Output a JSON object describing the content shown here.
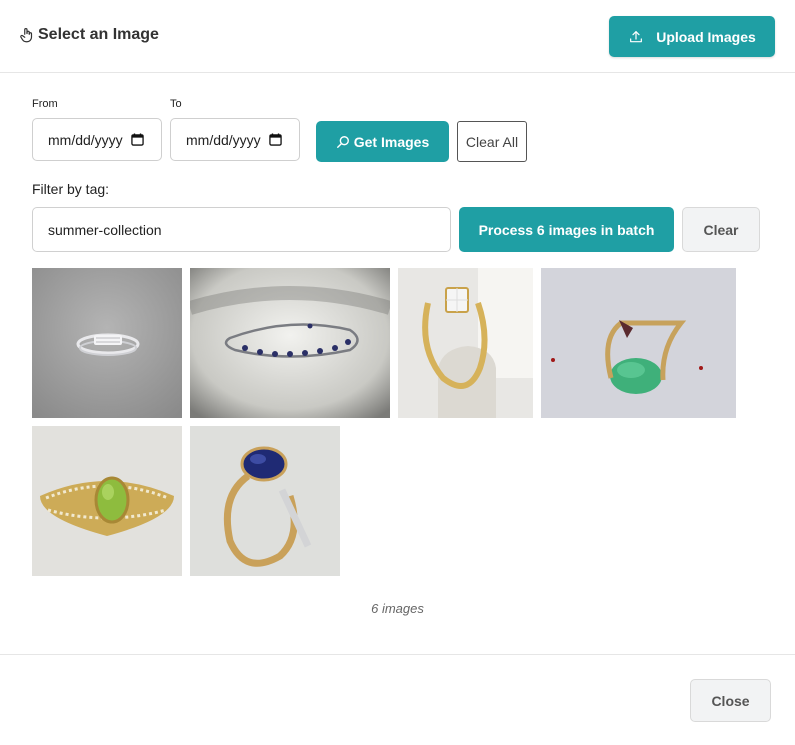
{
  "dialog": {
    "title": "Select an Image",
    "upload_label": "Upload Images"
  },
  "filters": {
    "from_label": "From",
    "to_label": "To",
    "from_placeholder": "mm/dd/yyyy",
    "to_placeholder": "mm/dd/yyyy",
    "get_images_label": "Get Images",
    "clear_all_label": "Clear All",
    "tag_label": "Filter by tag:",
    "tag_value": "summer-collection",
    "process_label": "Process 6 images in batch",
    "clear_label": "Clear"
  },
  "images": [
    {
      "name": "white-gold-band-ring"
    },
    {
      "name": "sapphire-tennis-bracelet"
    },
    {
      "name": "diamond-engagement-ring"
    },
    {
      "name": "gold-ring-with-green-stone"
    },
    {
      "name": "peridot-gold-ring"
    },
    {
      "name": "sapphire-gold-ring"
    }
  ],
  "status": {
    "count_text": "6 images"
  },
  "footer": {
    "close_label": "Close"
  },
  "colors": {
    "accent": "#1f9fa4",
    "secondary_bg": "#f2f3f4"
  }
}
